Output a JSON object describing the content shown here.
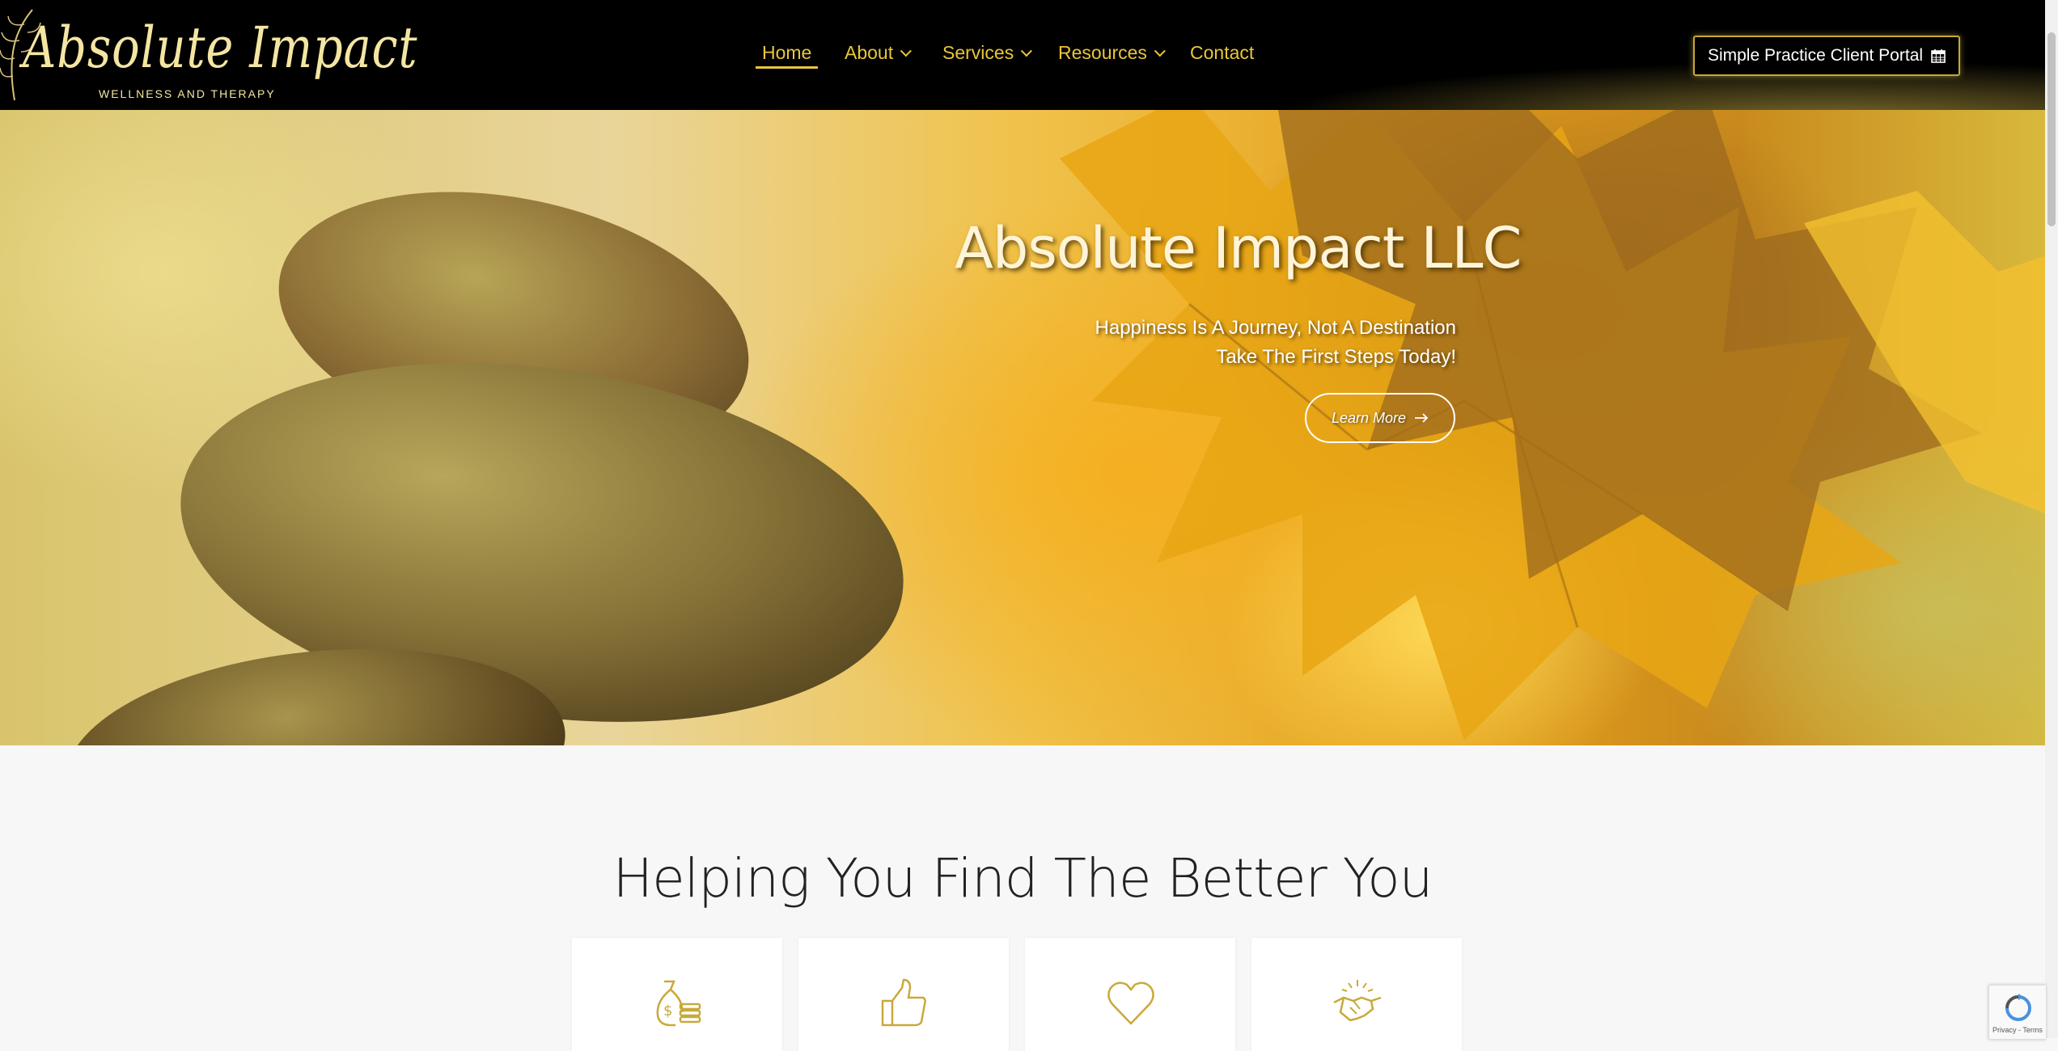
{
  "header": {
    "logo": {
      "script_text": "Absolute Impact",
      "subtitle": "WELLNESS AND THERAPY"
    },
    "nav": [
      {
        "label": "Home",
        "active": true,
        "has_dropdown": false
      },
      {
        "label": "About",
        "active": false,
        "has_dropdown": true
      },
      {
        "label": "Services",
        "active": false,
        "has_dropdown": true
      },
      {
        "label": "Resources",
        "active": false,
        "has_dropdown": true
      },
      {
        "label": "Contact",
        "active": false,
        "has_dropdown": false
      }
    ],
    "portal_button": {
      "label": "Simple Practice Client Portal",
      "icon": "calendar-icon"
    }
  },
  "hero": {
    "title": "Absolute Impact LLC",
    "subtitle_lines": [
      "Happiness Is A Journey, Not A Destination",
      "Take The First Steps Today!"
    ],
    "cta": {
      "label": "Learn More",
      "icon": "arrow-right-icon"
    }
  },
  "features": {
    "title": "Helping You Find The Better You",
    "cards": [
      {
        "icon": "money-bag-icon"
      },
      {
        "icon": "thumbs-up-icon"
      },
      {
        "icon": "heart-icon"
      },
      {
        "icon": "handshake-icon"
      }
    ]
  },
  "recaptcha": {
    "text": "Privacy - Terms"
  },
  "colors": {
    "accent_gold": "#e9c63a",
    "header_bg": "#000000",
    "icon_gold": "#c9a93c",
    "page_bg": "#f7f7f7"
  }
}
